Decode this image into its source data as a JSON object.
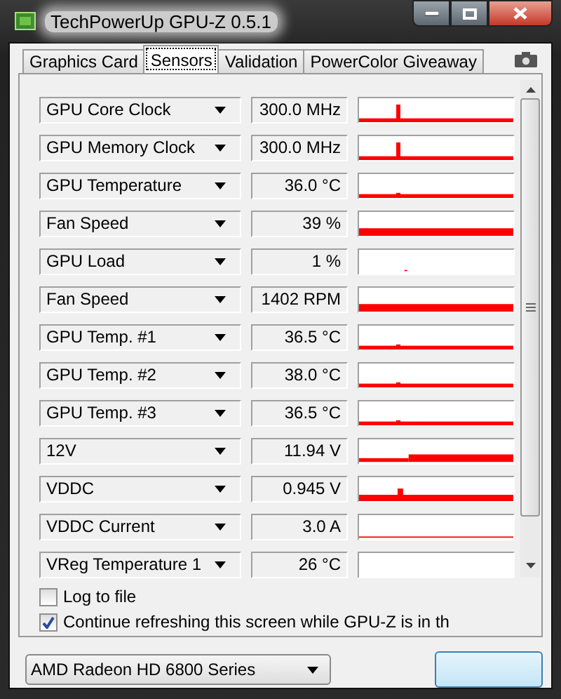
{
  "window": {
    "title": "TechPowerUp GPU-Z 0.5.1"
  },
  "tabs": [
    {
      "label": "Graphics Card",
      "selected": false
    },
    {
      "label": "Sensors",
      "selected": true
    },
    {
      "label": "Validation",
      "selected": false
    },
    {
      "label": "PowerColor Giveaway",
      "selected": false
    }
  ],
  "sensors": [
    {
      "name": "GPU Core Clock",
      "value": "300.0 MHz",
      "kind": "spike"
    },
    {
      "name": "GPU Memory Clock",
      "value": "300.0 MHz",
      "kind": "spike"
    },
    {
      "name": "GPU Temperature",
      "value": "36.0 °C",
      "kind": "bump"
    },
    {
      "name": "Fan Speed",
      "value": "39 %",
      "kind": "bar"
    },
    {
      "name": "GPU Load",
      "value": "1 %",
      "kind": "dot"
    },
    {
      "name": "Fan Speed",
      "value": "1402 RPM",
      "kind": "bar"
    },
    {
      "name": "GPU Temp. #1",
      "value": "36.5 °C",
      "kind": "bump"
    },
    {
      "name": "GPU Temp. #2",
      "value": "38.0 °C",
      "kind": "bump"
    },
    {
      "name": "GPU Temp. #3",
      "value": "36.5 °C",
      "kind": "bump"
    },
    {
      "name": "12V",
      "value": "11.94 V",
      "kind": "step"
    },
    {
      "name": "VDDC",
      "value": "0.945 V",
      "kind": "pulse"
    },
    {
      "name": "VDDC Current",
      "value": "3.0 A",
      "kind": "thin"
    },
    {
      "name": "VReg Temperature 1",
      "value": "26 °C",
      "kind": "empty"
    }
  ],
  "options": [
    {
      "label": "Log to file",
      "checked": false
    },
    {
      "label": "Continue refreshing this screen while GPU-Z is in th",
      "checked": true
    }
  ],
  "device": {
    "value": "AMD Radeon HD 6800 Series"
  }
}
